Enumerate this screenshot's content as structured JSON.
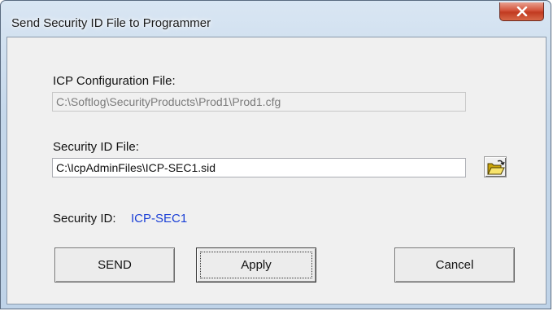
{
  "window": {
    "title": "Send Security ID File to Programmer",
    "close_icon": "close-icon"
  },
  "form": {
    "icp_config_label": "ICP Configuration File:",
    "icp_config_value": "C:\\Softlog\\SecurityProducts\\Prod1\\Prod1.cfg",
    "security_id_file_label": "Security ID File:",
    "security_id_file_value": "C:\\IcpAdminFiles\\ICP-SEC1.sid",
    "browse_icon": "open-folder-icon",
    "security_id_label": "Security ID:",
    "security_id_value": "ICP-SEC1",
    "security_id_color": "#1a3fd6"
  },
  "buttons": {
    "send": "SEND",
    "apply": "Apply",
    "cancel": "Cancel"
  }
}
